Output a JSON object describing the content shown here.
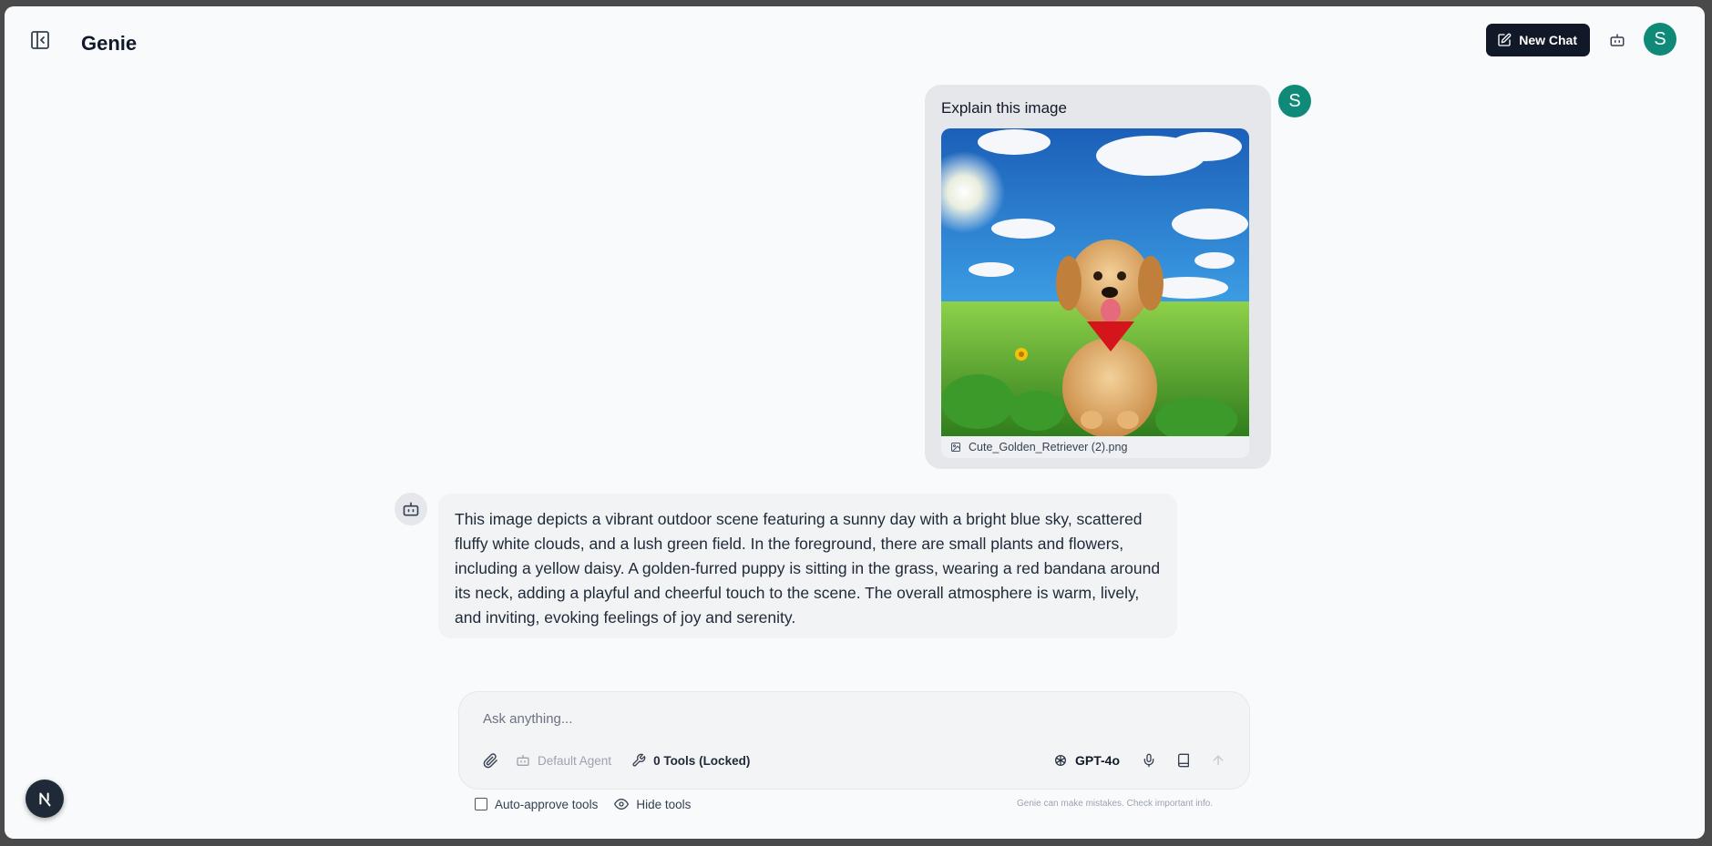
{
  "header": {
    "title": "Genie",
    "new_chat_label": "New Chat",
    "avatar_initial": "S"
  },
  "conversation": {
    "user_message": {
      "text": "Explain this image",
      "attachment_name": "Cute_Golden_Retriever (2).png",
      "avatar_initial": "S"
    },
    "assistant_message": {
      "text": "This image depicts a vibrant outdoor scene featuring a sunny day with a bright blue sky, scattered fluffy white clouds, and a lush green field. In the foreground, there are small plants and flowers, including a yellow daisy. A golden-furred puppy is sitting in the grass, wearing a red bandana around its neck, adding a playful and cheerful touch to the scene. The overall atmosphere is warm, lively, and inviting, evoking feelings of joy and serenity."
    }
  },
  "composer": {
    "placeholder": "Ask anything...",
    "agent_label": "Default Agent",
    "tools_label": "0 Tools (Locked)",
    "model_label": "GPT-4o"
  },
  "footer": {
    "auto_approve_label": "Auto-approve tools",
    "hide_tools_label": "Hide tools",
    "disclaimer": "Genie can make mistakes. Check important info."
  },
  "colors": {
    "accent_dark": "#111827",
    "avatar_teal": "#0f8a78",
    "background": "#f8fafc"
  }
}
